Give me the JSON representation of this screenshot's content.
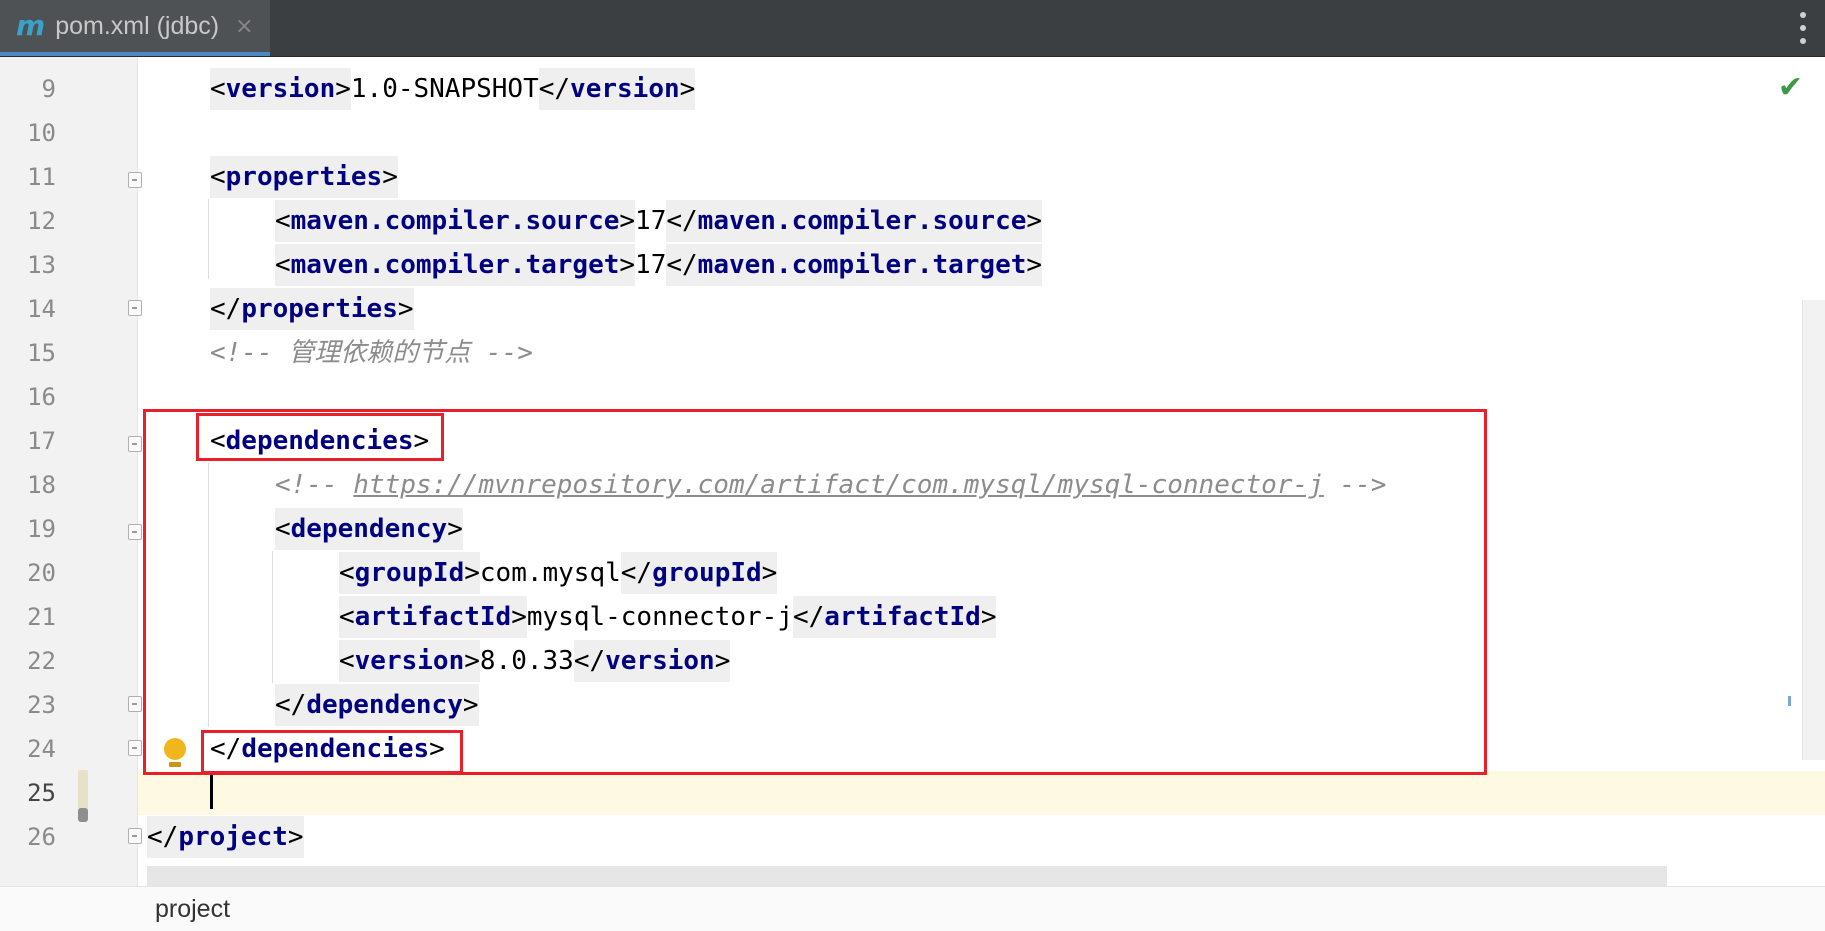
{
  "tab": {
    "icon": "m",
    "title": "pom.xml (jdbc)",
    "close": "×"
  },
  "status": {
    "inspection_icon": "checkmark-icon",
    "inspection_color": "#3a9a48"
  },
  "lines": {
    "n9": "9",
    "n10": "10",
    "n11": "11",
    "n12": "12",
    "n13": "13",
    "n14": "14",
    "n15": "15",
    "n16": "16",
    "n17": "17",
    "n18": "18",
    "n19": "19",
    "n20": "20",
    "n21": "21",
    "n22": "22",
    "n23": "23",
    "n24": "24",
    "n25": "25",
    "n26": "26"
  },
  "code": {
    "version_tag": "version",
    "version_value": "1.0-SNAPSHOT",
    "properties_tag": "properties",
    "source_tag": "maven.compiler.source",
    "source_value": "17",
    "target_tag": "maven.compiler.target",
    "target_value": "17",
    "comment1": "<!-- 管理依赖的节点 -->",
    "dependencies_tag": "dependencies",
    "comment2_open": "<!-- ",
    "comment2_url": "https://mvnrepository.com/artifact/com.mysql/mysql-connector-j",
    "comment2_close": " -->",
    "dependency_tag": "dependency",
    "groupId_tag": "groupId",
    "groupId_value": "com.mysql",
    "artifactId_tag": "artifactId",
    "artifactId_value": "mysql-connector-j",
    "dep_version_tag": "version",
    "dep_version_value": "8.0.33",
    "project_tag": "project"
  },
  "breadcrumb": {
    "item": "project"
  },
  "colors": {
    "tag": "#000080",
    "comment": "#8c8c8c",
    "highlight_box": "#e8202a"
  }
}
